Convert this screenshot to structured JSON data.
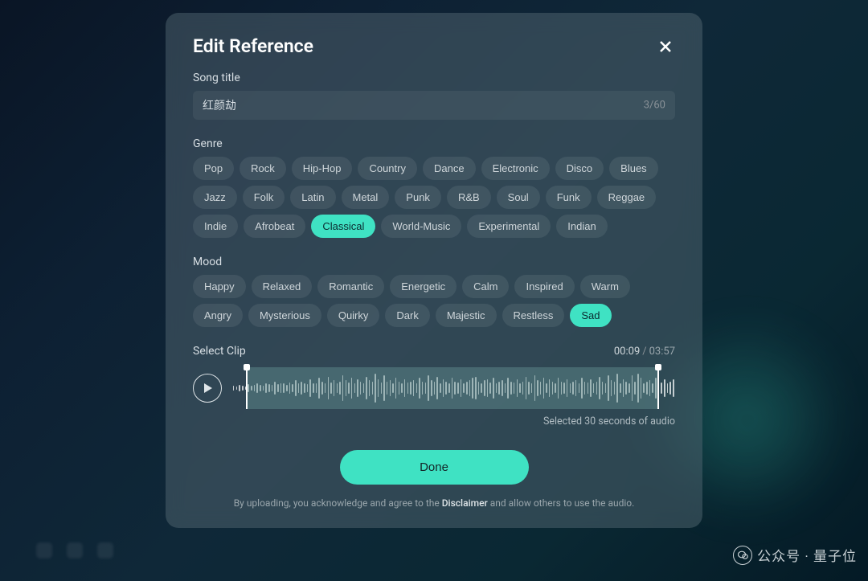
{
  "modal": {
    "title": "Edit Reference",
    "songTitleLabel": "Song title",
    "songTitleValue": "红颜劫",
    "charCount": "3/60",
    "genreLabel": "Genre",
    "genres": [
      {
        "label": "Pop",
        "active": false
      },
      {
        "label": "Rock",
        "active": false
      },
      {
        "label": "Hip-Hop",
        "active": false
      },
      {
        "label": "Country",
        "active": false
      },
      {
        "label": "Dance",
        "active": false
      },
      {
        "label": "Electronic",
        "active": false
      },
      {
        "label": "Disco",
        "active": false
      },
      {
        "label": "Blues",
        "active": false
      },
      {
        "label": "Jazz",
        "active": false
      },
      {
        "label": "Folk",
        "active": false
      },
      {
        "label": "Latin",
        "active": false
      },
      {
        "label": "Metal",
        "active": false
      },
      {
        "label": "Punk",
        "active": false
      },
      {
        "label": "R&B",
        "active": false
      },
      {
        "label": "Soul",
        "active": false
      },
      {
        "label": "Funk",
        "active": false
      },
      {
        "label": "Reggae",
        "active": false
      },
      {
        "label": "Indie",
        "active": false
      },
      {
        "label": "Afrobeat",
        "active": false
      },
      {
        "label": "Classical",
        "active": true
      },
      {
        "label": "World-Music",
        "active": false
      },
      {
        "label": "Experimental",
        "active": false
      },
      {
        "label": "Indian",
        "active": false
      }
    ],
    "moodLabel": "Mood",
    "moods": [
      {
        "label": "Happy",
        "active": false
      },
      {
        "label": "Relaxed",
        "active": false
      },
      {
        "label": "Romantic",
        "active": false
      },
      {
        "label": "Energetic",
        "active": false
      },
      {
        "label": "Calm",
        "active": false
      },
      {
        "label": "Inspired",
        "active": false
      },
      {
        "label": "Warm",
        "active": false
      },
      {
        "label": "Angry",
        "active": false
      },
      {
        "label": "Mysterious",
        "active": false
      },
      {
        "label": "Quirky",
        "active": false
      },
      {
        "label": "Dark",
        "active": false
      },
      {
        "label": "Majestic",
        "active": false
      },
      {
        "label": "Restless",
        "active": false
      },
      {
        "label": "Sad",
        "active": true
      }
    ],
    "selectClipLabel": "Select Clip",
    "clipCurrent": "00:09",
    "clipTotal": "03:57",
    "selectedInfo": "Selected 30 seconds of audio",
    "doneLabel": "Done",
    "disclaimerPre": "By uploading, you acknowledge and agree to the ",
    "disclaimerLink": "Disclaimer",
    "disclaimerPost": " and allow others to use the audio."
  },
  "watermark": "公众号 · 量子位"
}
